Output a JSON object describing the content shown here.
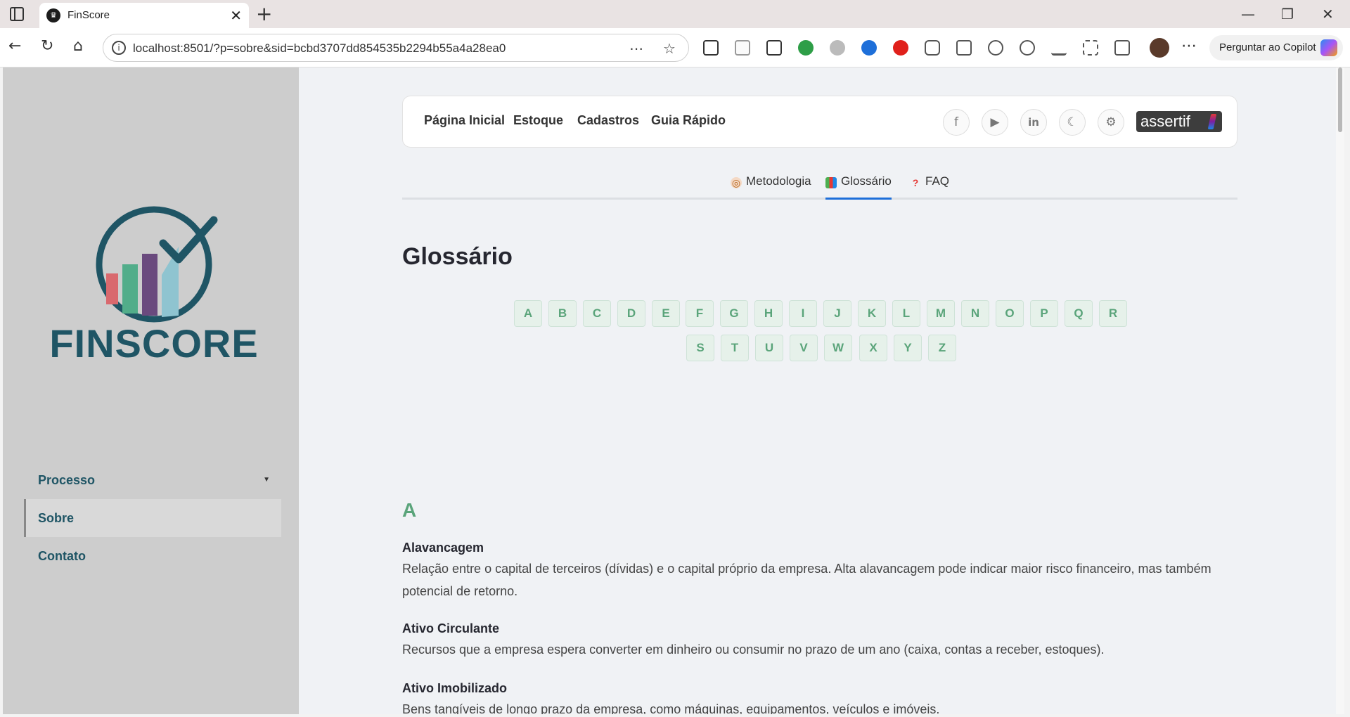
{
  "browser": {
    "tab_title": "FinScore",
    "tab_close": "✕",
    "new_tab": "+",
    "url": "localhost:8501/?p=sobre&sid=bcbd3707dd854535b2294b55a4a28ea0",
    "copilot_label": "Perguntar ao Copilot",
    "window_controls": {
      "minimize": "—",
      "restore": "❐",
      "close": "✕"
    },
    "icons": {
      "back": "←",
      "reload": "↻",
      "home": "⌂",
      "info": "i",
      "reader": "⋯",
      "favorite": "☆",
      "more": "⋯"
    }
  },
  "sidebar": {
    "logo_text": "FINSCORE",
    "items": [
      {
        "label": "Processo",
        "caret": "▼"
      },
      {
        "label": "Sobre"
      },
      {
        "label": "Contato"
      }
    ]
  },
  "topnav": {
    "links": [
      "Página Inicial",
      "Estoque",
      "Cadastros",
      "Guia Rápido"
    ],
    "icons": {
      "facebook": "f",
      "youtube": "▶",
      "linkedin": "in",
      "theme": "☾",
      "settings": "⚙"
    },
    "brand": "assertif"
  },
  "subtabs": [
    {
      "label": "Metodologia",
      "icon": "◎"
    },
    {
      "label": "Glossário",
      "icon": "▮"
    },
    {
      "label": "FAQ",
      "icon": "?"
    }
  ],
  "page": {
    "title": "Glossário",
    "letters_row1": [
      "A",
      "B",
      "C",
      "D",
      "E",
      "F",
      "G",
      "H",
      "I",
      "J",
      "K",
      "L",
      "M",
      "N",
      "O",
      "P",
      "Q",
      "R"
    ],
    "letters_row2": [
      "S",
      "T",
      "U",
      "V",
      "W",
      "X",
      "Y",
      "Z"
    ],
    "section_letter": "A",
    "terms": [
      {
        "term": "Alavancagem",
        "definition": "Relação entre o capital de terceiros (dívidas) e o capital próprio da empresa. Alta alavancagem pode indicar maior risco financeiro, mas também potencial de retorno."
      },
      {
        "term": "Ativo Circulante",
        "definition": "Recursos que a empresa espera converter em dinheiro ou consumir no prazo de um ano (caixa, contas a receber, estoques)."
      },
      {
        "term": "Ativo Imobilizado",
        "definition": "Bens tangíveis de longo prazo da empresa, como máquinas, equipamentos, veículos e imóveis."
      }
    ]
  },
  "colors": {
    "accent_green": "#5aa47a",
    "brand_teal": "#1f5565",
    "tab_active": "#1e6fd9"
  }
}
